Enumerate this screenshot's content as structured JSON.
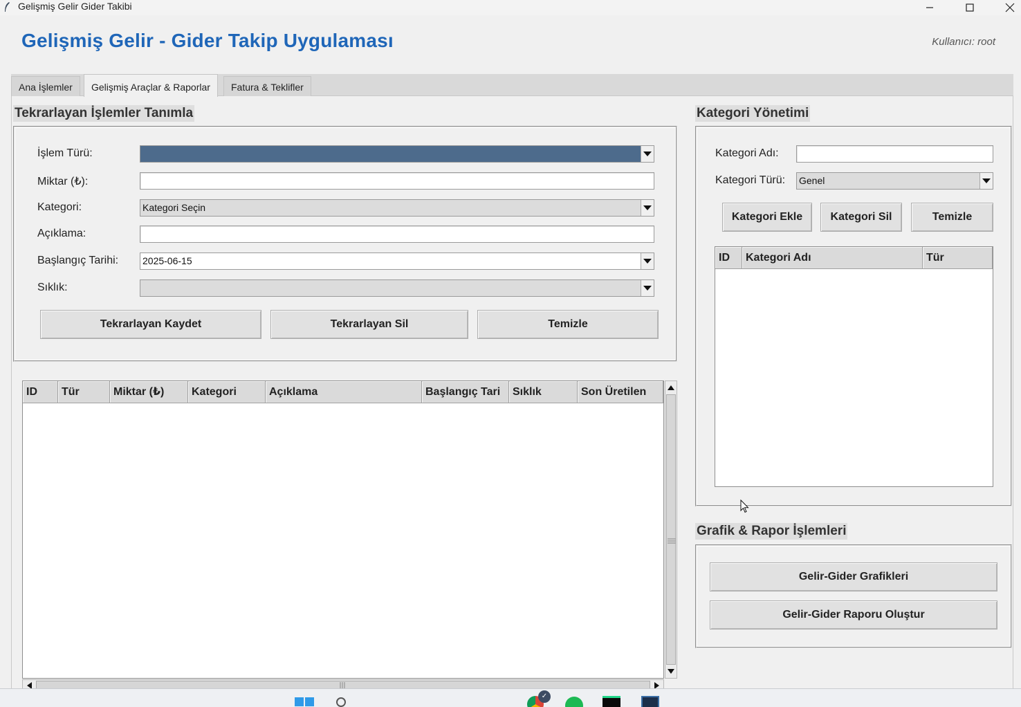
{
  "window": {
    "title": "Gelişmiş Gelir Gider Takibi",
    "icon": "feather-icon",
    "controls": [
      "minimize-icon",
      "maximize-icon",
      "close-icon"
    ]
  },
  "header": {
    "title": "Gelişmiş Gelir - Gider Takip Uygulaması",
    "user": "Kullanıcı: root",
    "title_color": "#1f66b8"
  },
  "tabs": [
    {
      "label": "Ana İşlemler",
      "active": false
    },
    {
      "label": "Gelişmiş Araçlar & Raporlar",
      "active": true
    },
    {
      "label": "Fatura & Teklifler",
      "active": false
    }
  ],
  "recurring": {
    "section_title": "Tekrarlayan İşlemler Tanımla",
    "fields": {
      "type_label": "İşlem Türü:",
      "type_value": "",
      "amount_label": "Miktar (₺):",
      "amount_value": "",
      "category_label": "Kategori:",
      "category_value": "Kategori Seçin",
      "description_label": "Açıklama:",
      "description_value": "",
      "start_date_label": "Başlangıç Tarihi:",
      "start_date_value": "2025-06-15",
      "frequency_label": "Sıklık:",
      "frequency_value": ""
    },
    "buttons": {
      "save": "Tekrarlayan Kaydet",
      "delete": "Tekrarlayan Sil",
      "clear": "Temizle"
    },
    "table": {
      "columns": [
        "ID",
        "Tür",
        "Miktar (₺)",
        "Kategori",
        "Açıklama",
        "Başlangıç Tari",
        "Sıklık",
        "Son Üretilen"
      ],
      "rows": []
    }
  },
  "category": {
    "section_title": "Kategori Yönetimi",
    "name_label": "Kategori Adı:",
    "name_value": "",
    "type_label": "Kategori Türü:",
    "type_value": "Genel",
    "buttons": {
      "add": "Kategori Ekle",
      "delete": "Kategori Sil",
      "clear": "Temizle"
    },
    "table": {
      "columns": [
        "ID",
        "Kategori Adı",
        "Tür"
      ],
      "rows": []
    }
  },
  "reports": {
    "section_title": "Grafik & Rapor İşlemleri",
    "buttons": {
      "charts": "Gelir-Gider Grafikleri",
      "report": "Gelir-Gider Raporu Oluştur"
    }
  },
  "taskbar": {
    "icons": [
      "windows-start-icon",
      "search-icon",
      "chrome-icon",
      "spotify-icon",
      "pycharm-icon",
      "terminal-icon"
    ]
  }
}
